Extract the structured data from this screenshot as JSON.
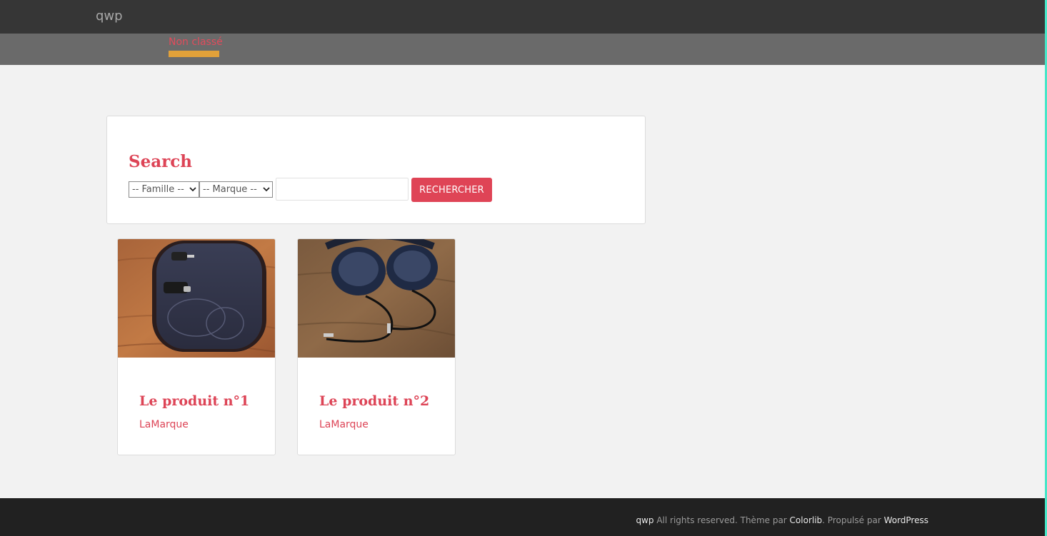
{
  "header": {
    "site_title": "qwp"
  },
  "menu": {
    "items": [
      {
        "label": "Non classé",
        "active": true
      }
    ],
    "active_underline_color": "#e1a13a"
  },
  "search": {
    "title": "Search",
    "famille_select": {
      "selected": "-- Famille --"
    },
    "marque_select": {
      "selected": "-- Marque --"
    },
    "query": {
      "value": "",
      "placeholder": ""
    },
    "button_label": "RECHERCHER"
  },
  "products": [
    {
      "title": "Le produit n°1",
      "brand": "LaMarque",
      "image": "headphone-case-photo"
    },
    {
      "title": "Le produit n°2",
      "brand": "LaMarque",
      "image": "headphones-photo"
    }
  ],
  "footer": {
    "site": "qwp",
    "rights": " All rights reserved. Thème par ",
    "theme_author": "Colorlib",
    "powered": ". Propulsé par ",
    "platform": "WordPress"
  },
  "colors": {
    "accent": "#dd4456",
    "topbar": "#363636",
    "menubar": "#6a6a6a",
    "footer": "#212121",
    "page_bg": "#f2f2f2"
  }
}
